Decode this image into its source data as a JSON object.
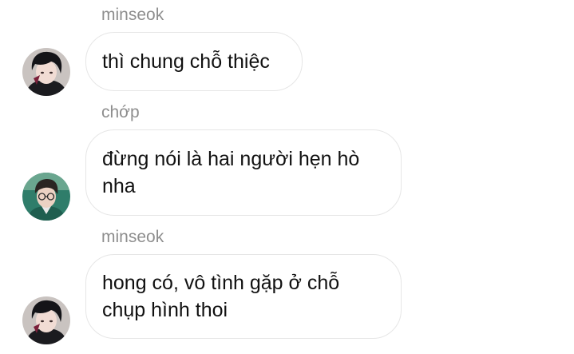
{
  "messages": [
    {
      "sender": "minseok",
      "text": "thì chung chỗ thiệc",
      "avatar_icon": "dark-hair-person-avatar-icon"
    },
    {
      "sender": "chớp",
      "text": "đừng nói là hai người hẹn hò nha",
      "avatar_icon": "glasses-person-avatar-icon"
    },
    {
      "sender": "minseok",
      "text": "hong có, vô tình gặp ở chỗ chụp hình thoi",
      "avatar_icon": "dark-hair-person-avatar-icon"
    }
  ]
}
